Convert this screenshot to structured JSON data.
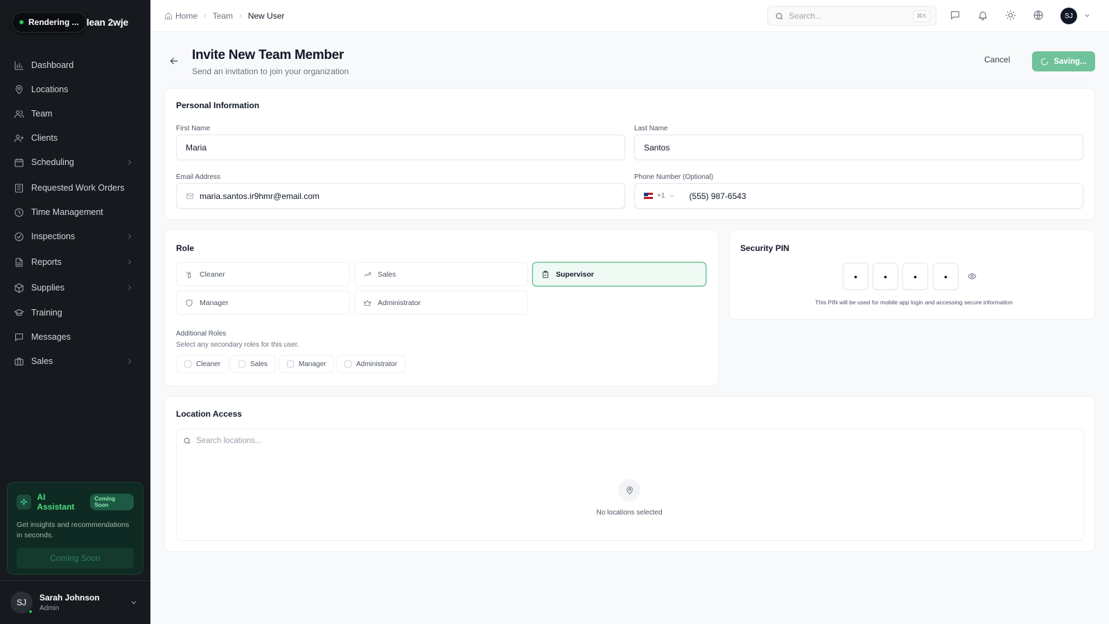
{
  "sidebar": {
    "status": "Rendering ...",
    "brand": "lean 2wje",
    "items": [
      {
        "label": "Dashboard",
        "icon": "bar-chart-icon",
        "has_children": false
      },
      {
        "label": "Locations",
        "icon": "map-pin-icon",
        "has_children": false
      },
      {
        "label": "Team",
        "icon": "users-icon",
        "has_children": false
      },
      {
        "label": "Clients",
        "icon": "user-plus-icon",
        "has_children": false
      },
      {
        "label": "Scheduling",
        "icon": "calendar-icon",
        "has_children": true
      },
      {
        "label": "Requested Work Orders",
        "icon": "building-icon",
        "has_children": false
      },
      {
        "label": "Time Management",
        "icon": "clock-icon",
        "has_children": false
      },
      {
        "label": "Inspections",
        "icon": "check-circle-icon",
        "has_children": true
      },
      {
        "label": "Reports",
        "icon": "file-text-icon",
        "has_children": true
      },
      {
        "label": "Supplies",
        "icon": "package-icon",
        "has_children": true
      },
      {
        "label": "Training",
        "icon": "graduation-cap-icon",
        "has_children": false
      },
      {
        "label": "Messages",
        "icon": "message-square-icon",
        "has_children": false
      },
      {
        "label": "Sales",
        "icon": "briefcase-icon",
        "has_children": true
      }
    ],
    "ai_card": {
      "title": "AI Assistant",
      "badge": "Coming Soon",
      "description": "Get insights and recommendations in seconds.",
      "button": "Coming Soon"
    },
    "user": {
      "initials": "SJ",
      "name": "Sarah Johnson",
      "role": "Admin"
    }
  },
  "topbar": {
    "breadcrumbs": [
      "Home",
      "Team",
      "New User"
    ],
    "search_placeholder": "Search...",
    "search_shortcut": "⌘K",
    "avatar_initials": "SJ"
  },
  "header": {
    "title": "Invite New Team Member",
    "subtitle": "Send an invitation to join your organization",
    "cancel_label": "Cancel",
    "save_label": "Saving..."
  },
  "personal": {
    "title": "Personal Information",
    "first_name_label": "First Name",
    "first_name_value": "Maria",
    "last_name_label": "Last Name",
    "last_name_value": "Santos",
    "email_label": "Email Address",
    "email_value": "maria.santos.ir9hmr@email.com",
    "phone_label": "Phone Number (Optional)",
    "phone_country_code": "+1",
    "phone_value": "(555) 987-6543"
  },
  "role": {
    "title": "Role",
    "options": [
      "Cleaner",
      "Sales",
      "Supervisor",
      "Manager",
      "Administrator"
    ],
    "selected": "Supervisor",
    "additional_title": "Additional Roles",
    "additional_subtitle": "Select any secondary roles for this user.",
    "additional_options": [
      "Cleaner",
      "Sales",
      "Manager",
      "Administrator"
    ]
  },
  "pin": {
    "title": "Security PIN",
    "digits": [
      "•",
      "•",
      "•",
      "•"
    ],
    "note": "This PIN will be used for mobile app login and accessing secure information"
  },
  "location": {
    "title": "Location Access",
    "search_placeholder": "Search locations...",
    "empty_text": "No locations selected"
  },
  "colors": {
    "sidebar_bg": "#16191d",
    "accent": "#5bbd8e",
    "save_button": "#6fc29a",
    "ai_title": "#4ade80"
  }
}
